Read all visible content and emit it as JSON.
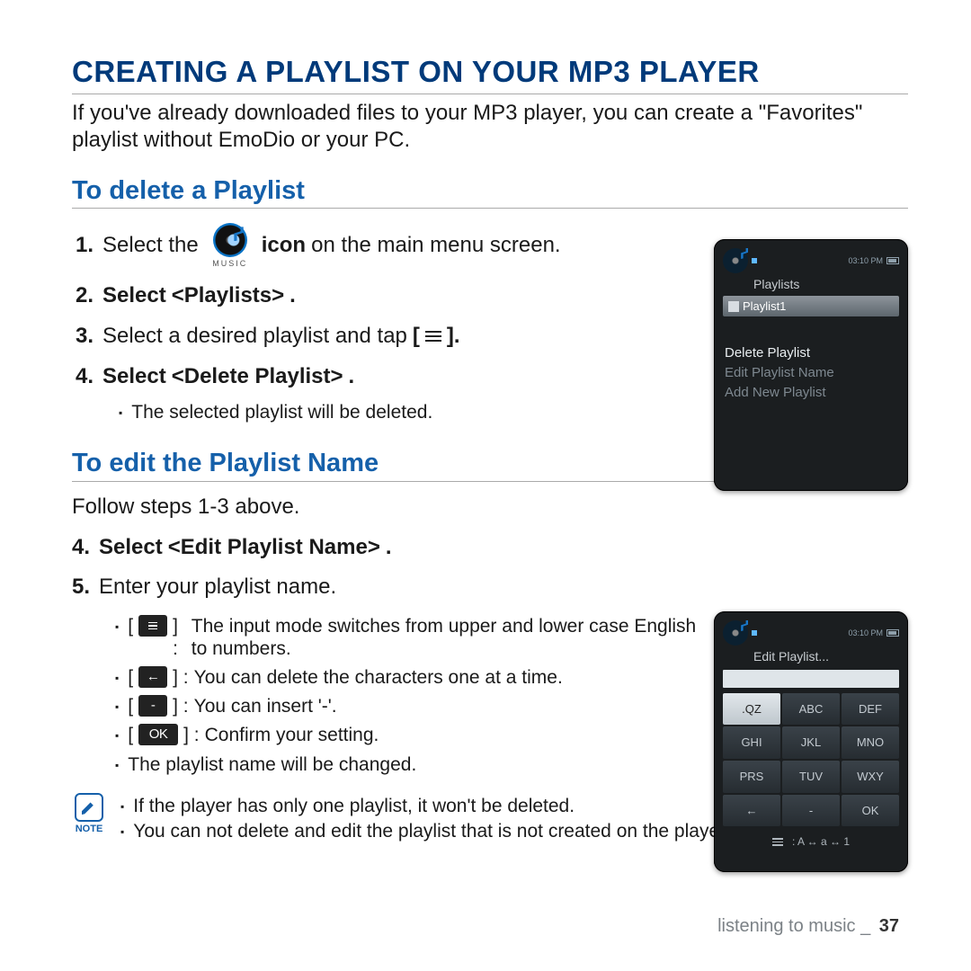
{
  "title": "CREATING A PLAYLIST ON YOUR MP3 PLAYER",
  "intro": "If you've already downloaded files to your MP3 player, you can create a \"Favorites\" playlist without EmoDio or your PC.",
  "section1": {
    "heading": "To delete a Playlist",
    "step1": {
      "num": "1.",
      "a": "Select the",
      "b": "icon",
      "c": "on the main menu screen."
    },
    "music_label": "MUSIC",
    "step2": {
      "num": "2.",
      "a": "Select",
      "b": "<Playlists>",
      "c": "."
    },
    "step3": {
      "num": "3.",
      "a": "Select a desired playlist and tap",
      "menu": "≡",
      "b": "[",
      "c": "]."
    },
    "step4": {
      "num": "4.",
      "a": "Select",
      "b": "<Delete Playlist>",
      "c": "."
    },
    "sub": "The selected playlist will be deleted."
  },
  "section2": {
    "heading": "To edit the Playlist Name",
    "follow": "Follow steps 1-3 above.",
    "step4": {
      "num": "4.",
      "a": "Select",
      "b": "<Edit Playlist Name>",
      "c": "."
    },
    "step5": {
      "num": "5.",
      "a": "Enter your playlist name."
    },
    "b_mode": {
      "desc": "The input mode switches from upper and lower case English to numbers."
    },
    "b_back": {
      "icon": "←",
      "desc": "You can delete the characters one at a time."
    },
    "b_dash": {
      "icon": "-",
      "desc": "You can insert '-'."
    },
    "b_ok": {
      "icon": "OK",
      "desc": "Confirm your setting."
    },
    "final": "The playlist name will be changed."
  },
  "notes": {
    "label": "NOTE",
    "n1": "If the player has only one playlist, it won't be deleted.",
    "n2": "You can not delete and edit the playlist that is not created on the player."
  },
  "footer": {
    "section": "listening to music _",
    "page": "37"
  },
  "device1": {
    "time": "03:10 PM",
    "title": "Playlists",
    "selected": "Playlist1",
    "opt1": "Delete Playlist",
    "opt2": "Edit Playlist Name",
    "opt3": "Add New Playlist"
  },
  "device2": {
    "time": "03:10 PM",
    "title": "Edit Playlist...",
    "keys": {
      "r1": [
        ".QZ",
        "ABC",
        "DEF"
      ],
      "r2": [
        "GHI",
        "JKL",
        "MNO"
      ],
      "r3": [
        "PRS",
        "TUV",
        "WXY"
      ],
      "r4": [
        "←",
        "-",
        "OK"
      ]
    },
    "mode": ": A  ↔  a  ↔  1"
  }
}
